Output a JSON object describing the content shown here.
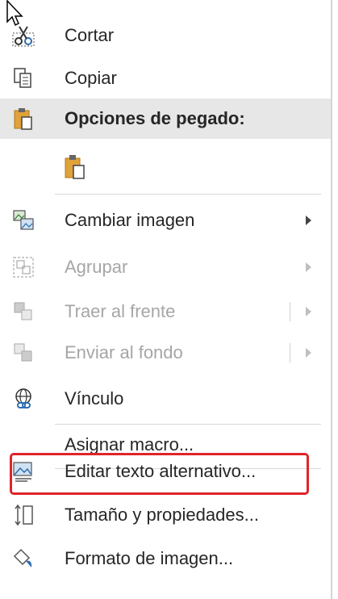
{
  "menu": {
    "cut": "Cortar",
    "copy": "Copiar",
    "paste_options": "Opciones de pegado:",
    "change_image": "Cambiar imagen",
    "group": "Agrupar",
    "bring_front": "Traer al frente",
    "send_back": "Enviar al fondo",
    "link": "Vínculo",
    "assign_macro": "Asignar macro...",
    "alt_text": "Editar texto alternativo...",
    "size_props": "Tamaño y propiedades...",
    "format_image": "Formato de imagen..."
  },
  "colors": {
    "highlight_border": "#e0242b",
    "paste_header_bg": "#e7e7e7",
    "disabled_text": "#a6a6a6"
  }
}
